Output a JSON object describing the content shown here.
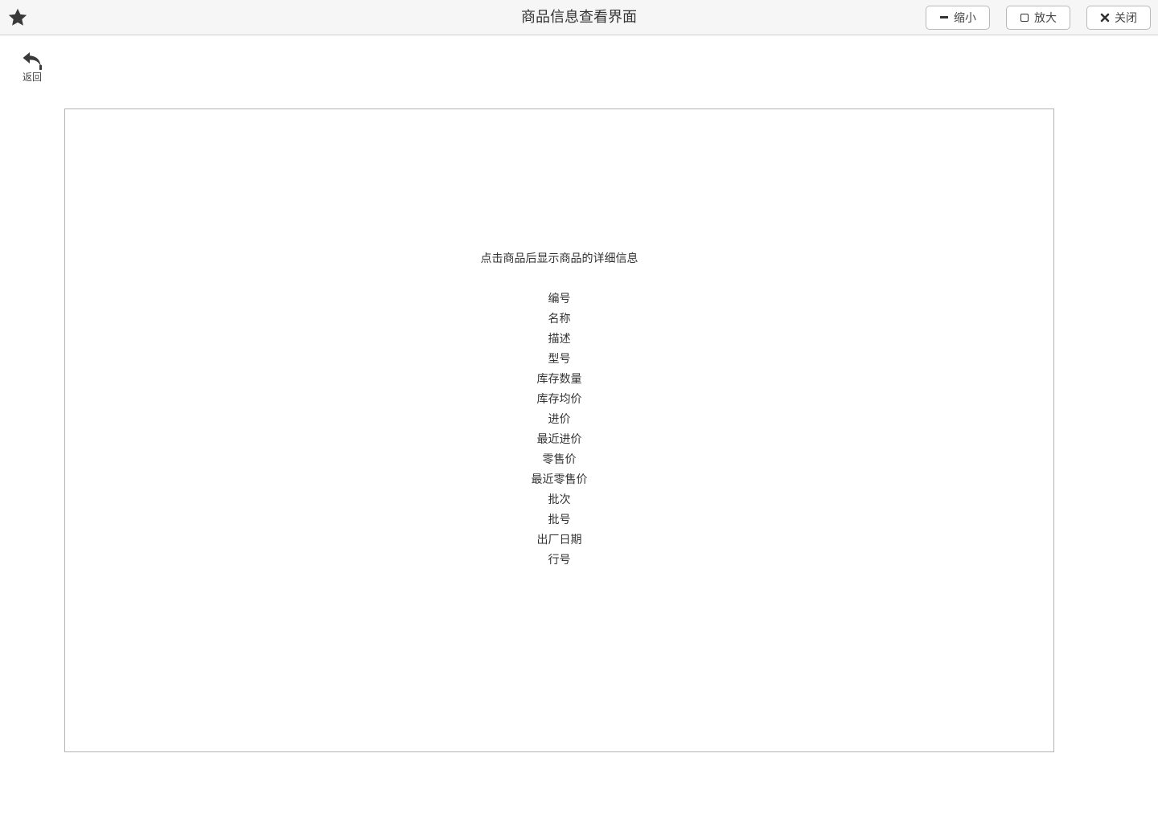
{
  "window": {
    "title": "商品信息查看界面",
    "buttons": {
      "minimize": "缩小",
      "maximize": "放大",
      "close": "关闭"
    },
    "icons": {
      "favorite": "star-icon",
      "minimize": "minus-icon",
      "maximize": "square-icon",
      "close": "x-icon"
    }
  },
  "toolbar": {
    "back_label": "返回",
    "back_icon": "reply-arrow-icon"
  },
  "detail_panel": {
    "hint": "点击商品后显示商品的详细信息",
    "fields": [
      "编号",
      "名称",
      "描述",
      "型号",
      "库存数量",
      "库存均价",
      "进价",
      "最近进价",
      "零售价",
      "最近零售价",
      "批次",
      "批号",
      "出厂日期",
      "行号"
    ]
  }
}
